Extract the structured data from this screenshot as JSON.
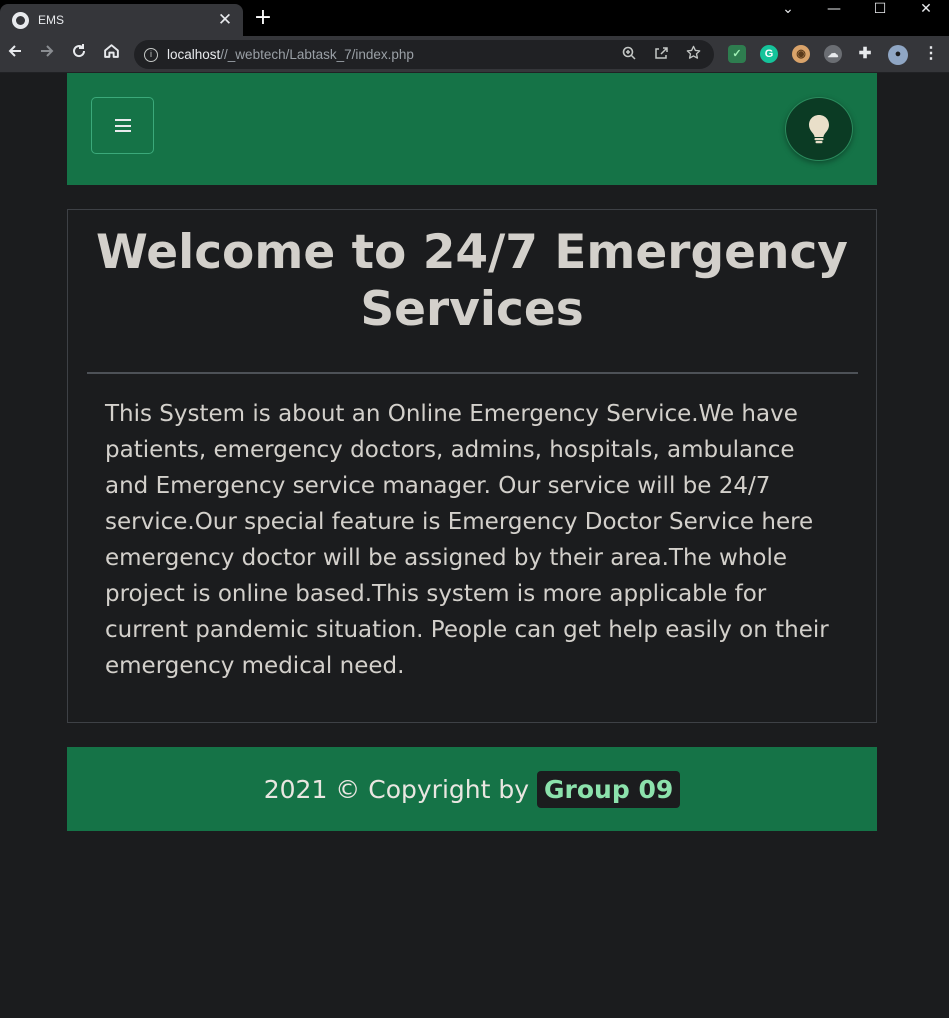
{
  "browser": {
    "tab_title": "EMS",
    "tab_close": "✕",
    "new_tab": "+",
    "url_host": "localhost",
    "url_path": "//_webtech/Labtask_7/index.php",
    "window_controls": [
      "⌄",
      "—",
      "☐",
      "✕"
    ]
  },
  "navbar": {
    "background": "#157347",
    "menu_icon": "hamburger-icon",
    "theme_icon": "lightbulb-icon"
  },
  "main": {
    "headline_prefix": "Welcome to ",
    "headline_bold": "24/7 Emergency Services",
    "description": "This System is about an Online Emergency Service.We have patients, emergency doctors, admins, hospitals, ambulance and Emergency service manager. Our service will be 24/7 service.Our special feature is Emergency Doctor Service here emergency doctor will be assigned by their area.The whole project is online based.This system is more applicable for current pandemic situation. People can get help easily on their emergency medical need."
  },
  "footer": {
    "text": "2021 © Copyright by",
    "link_label": "Group 09",
    "link_color": "#8ce2ac"
  }
}
